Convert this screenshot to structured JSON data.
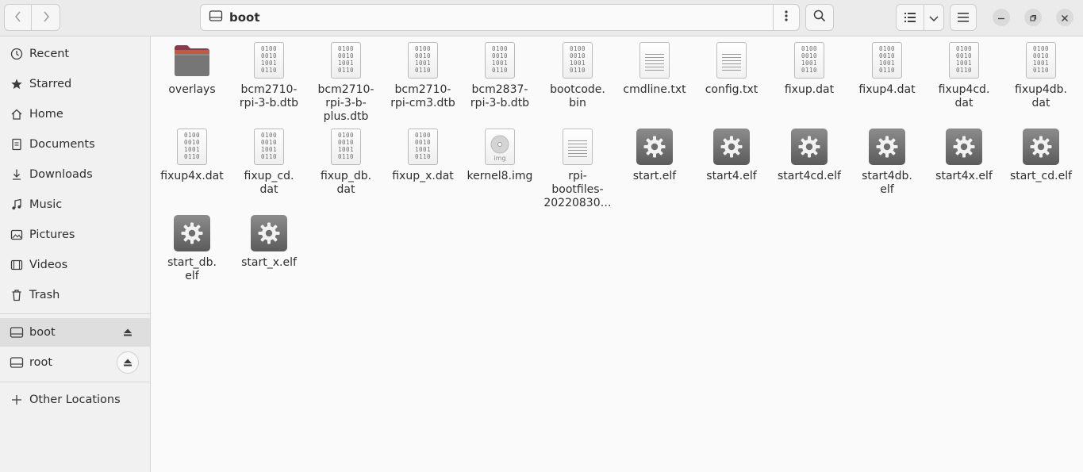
{
  "window": {
    "path_label": "boot"
  },
  "sidebar": {
    "places": [
      {
        "label": "Recent",
        "icon": "clock-icon"
      },
      {
        "label": "Starred",
        "icon": "star-icon"
      },
      {
        "label": "Home",
        "icon": "home-icon"
      },
      {
        "label": "Documents",
        "icon": "document-icon"
      },
      {
        "label": "Downloads",
        "icon": "download-icon"
      },
      {
        "label": "Music",
        "icon": "music-icon"
      },
      {
        "label": "Pictures",
        "icon": "picture-icon"
      },
      {
        "label": "Videos",
        "icon": "video-icon"
      },
      {
        "label": "Trash",
        "icon": "trash-icon"
      }
    ],
    "devices": [
      {
        "label": "boot",
        "icon": "drive-icon",
        "active": true
      },
      {
        "label": "root",
        "icon": "drive-icon",
        "active": false
      }
    ],
    "other_locations": "Other Locations"
  },
  "files": [
    {
      "name": "overlays",
      "type": "folder"
    },
    {
      "name": "bcm2710-rpi-3-b.dtb",
      "type": "binary"
    },
    {
      "name": "bcm2710-rpi-3-b-plus.dtb",
      "type": "binary"
    },
    {
      "name": "bcm2710-rpi-cm3.dtb",
      "type": "binary"
    },
    {
      "name": "bcm2837-rpi-3-b.dtb",
      "type": "binary"
    },
    {
      "name": "bootcode.bin",
      "type": "binary"
    },
    {
      "name": "cmdline.txt",
      "type": "text"
    },
    {
      "name": "config.txt",
      "type": "text"
    },
    {
      "name": "fixup.dat",
      "type": "binary"
    },
    {
      "name": "fixup4.dat",
      "type": "binary"
    },
    {
      "name": "fixup4cd.dat",
      "type": "binary"
    },
    {
      "name": "fixup4db.dat",
      "type": "binary"
    },
    {
      "name": "fixup4x.dat",
      "type": "binary"
    },
    {
      "name": "fixup_cd.dat",
      "type": "binary"
    },
    {
      "name": "fixup_db.dat",
      "type": "binary"
    },
    {
      "name": "fixup_x.dat",
      "type": "binary"
    },
    {
      "name": "kernel8.img",
      "type": "image"
    },
    {
      "name": "rpi-bootfiles-20220830…",
      "type": "text"
    },
    {
      "name": "start.elf",
      "type": "executable"
    },
    {
      "name": "start4.elf",
      "type": "executable"
    },
    {
      "name": "start4cd.elf",
      "type": "executable"
    },
    {
      "name": "start4db.elf",
      "type": "executable"
    },
    {
      "name": "start4x.elf",
      "type": "executable"
    },
    {
      "name": "start_cd.elf",
      "type": "executable"
    },
    {
      "name": "start_db.elf",
      "type": "executable"
    },
    {
      "name": "start_x.elf",
      "type": "executable"
    }
  ],
  "file_display_names": [
    [
      "overlays"
    ],
    [
      "bcm2710-",
      "rpi-3-b.dtb"
    ],
    [
      "bcm2710-",
      "rpi-3-b-",
      "plus.dtb"
    ],
    [
      "bcm2710-",
      "rpi-cm3.dtb"
    ],
    [
      "bcm2837-",
      "rpi-3-b.dtb"
    ],
    [
      "bootcode.",
      "bin"
    ],
    [
      "cmdline.txt"
    ],
    [
      "config.txt"
    ],
    [
      "fixup.dat"
    ],
    [
      "fixup4.dat"
    ],
    [
      "fixup4cd.",
      "dat"
    ],
    [
      "fixup4db.",
      "dat"
    ],
    [
      "fixup4x.dat"
    ],
    [
      "fixup_cd.",
      "dat"
    ],
    [
      "fixup_db.",
      "dat"
    ],
    [
      "fixup_x.dat"
    ],
    [
      "kernel8.img"
    ],
    [
      "rpi-",
      "bootfiles-",
      "20220830…"
    ],
    [
      "start.elf"
    ],
    [
      "start4.elf"
    ],
    [
      "start4cd.elf"
    ],
    [
      "start4db.",
      "elf"
    ],
    [
      "start4x.elf"
    ],
    [
      "start_cd.elf"
    ],
    [
      "start_db.",
      "elf"
    ],
    [
      "start_x.elf"
    ]
  ],
  "binary_icon_text": [
    "0100",
    "0010",
    "1001",
    "0110"
  ],
  "image_icon_text": "img"
}
